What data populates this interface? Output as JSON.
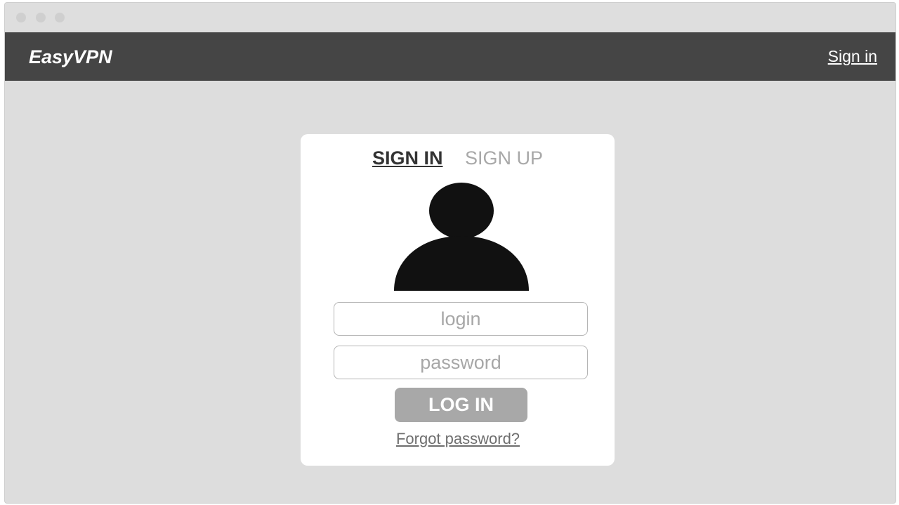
{
  "navbar": {
    "brand": "EasyVPN",
    "sign_in_link": "Sign in"
  },
  "auth_card": {
    "tabs": [
      {
        "label": "SIGN IN",
        "active": true
      },
      {
        "label": "SIGN UP",
        "active": false
      }
    ],
    "avatar_icon": "user-silhouette-icon",
    "login_field": {
      "value": "",
      "placeholder": "login"
    },
    "password_field": {
      "value": "",
      "placeholder": "password"
    },
    "login_button_label": "LOG IN",
    "forgot_password_link": "Forgot password?"
  },
  "colors": {
    "navbar_bg": "#454545",
    "page_bg": "#dddddd",
    "card_bg": "#ffffff",
    "button_bg": "#a8a8a8",
    "active_tab": "#333333",
    "inactive_tab": "#a8a8a8",
    "avatar": "#111111"
  }
}
